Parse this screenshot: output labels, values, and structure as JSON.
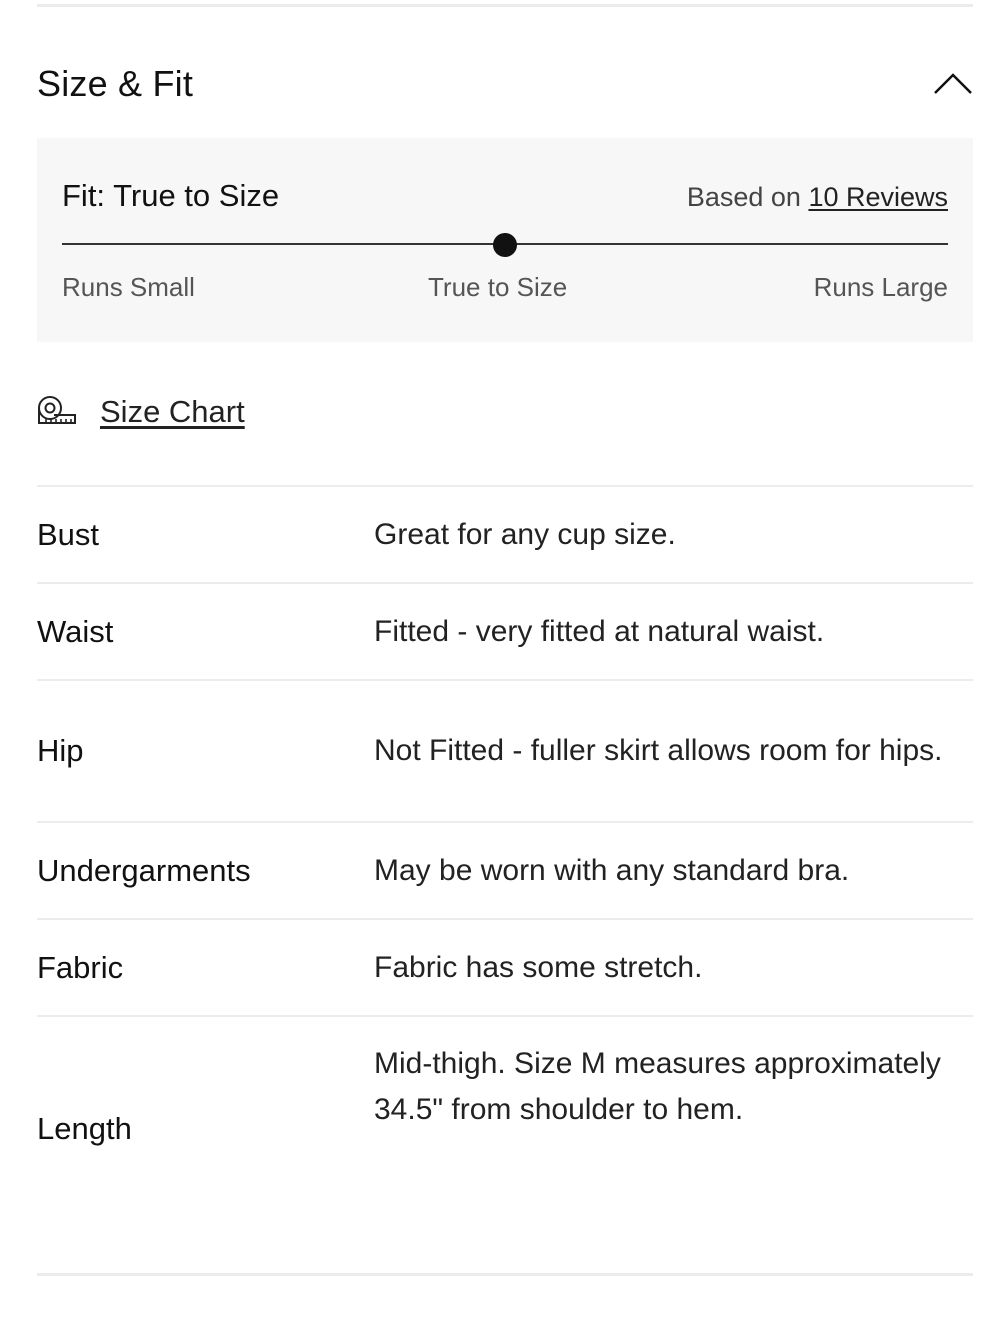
{
  "section": {
    "title": "Size & Fit",
    "chevron_icon": "chevron-up-icon"
  },
  "fit": {
    "label": "Fit: True to Size",
    "reviews_prefix": "Based on",
    "reviews_link": "10 Reviews",
    "scale": {
      "left": "Runs Small",
      "middle": "True to Size",
      "right": "Runs Large"
    },
    "position": 0.5
  },
  "size_chart": {
    "icon": "measuring-tape-icon",
    "label": "Size Chart"
  },
  "details": [
    {
      "label": "Bust",
      "value": "Great for any cup size."
    },
    {
      "label": "Waist",
      "value": "Fitted - very fitted at natural waist."
    },
    {
      "label": "Hip",
      "value": "Not Fitted - fuller skirt allows room for hips."
    },
    {
      "label": "Undergarments",
      "value": "May be worn with any standard bra."
    },
    {
      "label": "Fabric",
      "value": "Fabric has some stretch."
    },
    {
      "label": "Length",
      "value": "Mid-thigh. Size M measures approximately 34.5\" from shoulder to hem."
    }
  ]
}
